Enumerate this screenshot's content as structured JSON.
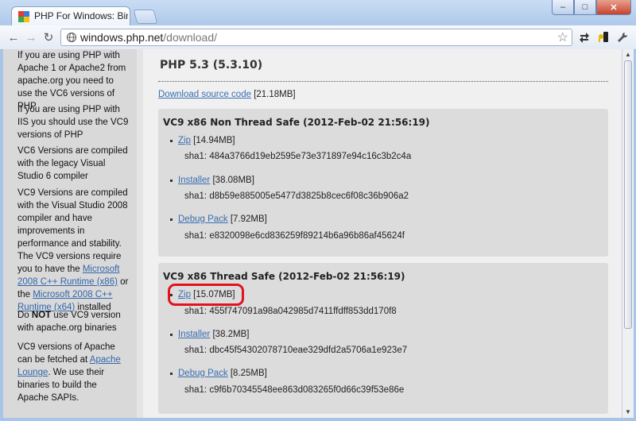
{
  "browser": {
    "tab_title": "PHP For Windows: Binari",
    "url_host": "windows.php.net",
    "url_path": "/download/",
    "win_min": "–",
    "win_max": "□",
    "win_close": "✕"
  },
  "icons": {
    "back": "←",
    "forward": "→",
    "reload": "↻",
    "star": "☆",
    "wrench": "🔧"
  },
  "sidebar": {
    "p1": "If you are using PHP with Apache 1 or Apache2 from apache.org you need to use the VC6 versions of PHP",
    "p2": "If you are using PHP with IIS you should use the VC9 versions of PHP",
    "p3": "VC6 Versions are compiled with the legacy Visual Studio 6 compiler",
    "p4_a": "VC9 Versions are compiled with the Visual Studio 2008 compiler and have improvements in performance and stability. The VC9 versions require you to have the ",
    "p4_link1": "Microsoft 2008 C++ Runtime (x86)",
    "p4_b": " or the ",
    "p4_link2": "Microsoft 2008 C++ Runtime (x64)",
    "p4_c": " installed",
    "p5_a": "Do ",
    "p5_bold": "NOT",
    "p5_b": " use VC9 version with apache.org binaries",
    "p6_a": "VC9 versions of Apache can be fetched at ",
    "p6_link": "Apache Lounge",
    "p6_b": ". We use their binaries to build the Apache SAPIs."
  },
  "main": {
    "title": "PHP 5.3 (5.3.10)",
    "source_link": "Download source code",
    "source_size": " [21.18MB]",
    "nts": {
      "title": "VC9 x86 Non Thread Safe (2012-Feb-02 21:56:19)",
      "zip_link": "Zip",
      "zip_size": " [14.94MB]",
      "zip_sha": "sha1: 484a3766d19eb2595e73e371897e94c16c3b2c4a",
      "inst_link": "Installer",
      "inst_size": " [38.08MB]",
      "inst_sha": "sha1: d8b59e885005e5477d3825b8cec6f08c36b906a2",
      "debug_link": "Debug Pack",
      "debug_size": " [7.92MB]",
      "debug_sha": "sha1: e8320098e6cd836259f89214b6a96b86af45624f"
    },
    "ts": {
      "title": "VC9 x86 Thread Safe (2012-Feb-02 21:56:19)",
      "zip_link": "Zip",
      "zip_size": " [15.07MB]",
      "zip_sha": "sha1: 455f747091a98a042985d7411ffdff853dd170f8",
      "inst_link": "Installer",
      "inst_size": " [38.2MB]",
      "inst_sha": "sha1: dbc45f54302078710eae329dfd2a5706a1e923e7",
      "debug_link": "Debug Pack",
      "debug_size": " [8.25MB]",
      "debug_sha": "sha1: c9f6b70345548ee863d083265f0d66c39f53e86e"
    }
  }
}
